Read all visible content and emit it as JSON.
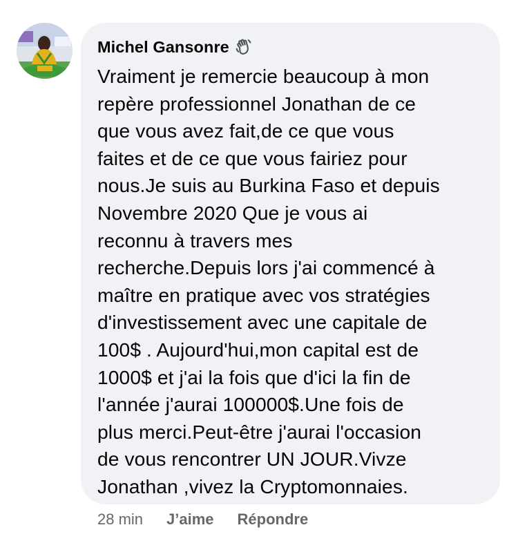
{
  "comment": {
    "author": "Michel Gansonre",
    "badge_icon": "wave-hand-icon",
    "text": "Vraiment je remercie beaucoup à mon\nrepère professionnel Jonathan de ce\nque vous avez fait,de ce que vous\nfaites et de ce que vous fairiez pour\nnous.Je suis au Burkina Faso et depuis\nNovembre 2020 Que je vous ai\nreconnu à travers mes\nrecherche.Depuis lors j'ai commencé à\nmaître en pratique avec vos stratégies\nd'investissement avec une capitale de\n100$ . Aujourd'hui,mon capital est de\n1000$ et j'ai la fois que d'ici la fin de\nl'année j'aurai 100000$.Une fois de\nplus merci.Peut-être j'aurai l'occasion\nde vous rencontrer UN JOUR.Vivze\nJonathan ,vivez la Cryptomonnaies.",
    "timestamp": "28 min",
    "like_label": "J’aime",
    "reply_label": "Répondre"
  },
  "colors": {
    "bubble_bg": "#f0f2f5",
    "text": "#050505",
    "meta": "#65676b"
  }
}
